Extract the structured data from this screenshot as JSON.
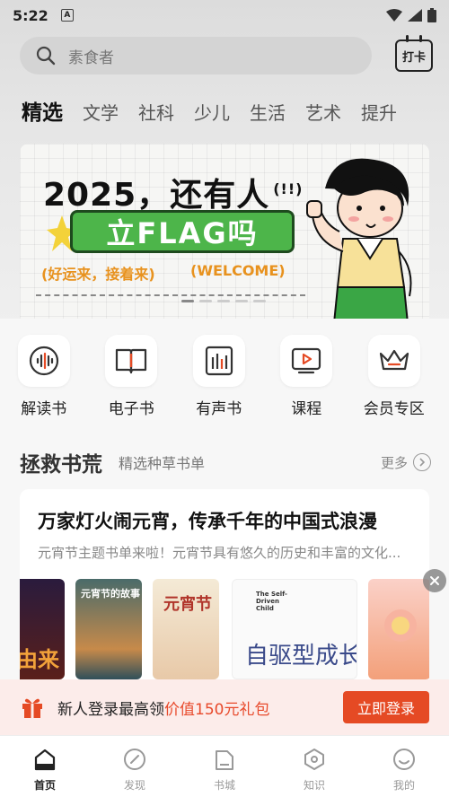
{
  "status_bar": {
    "time": "5:22",
    "notification_badge": "A"
  },
  "search": {
    "placeholder": "素食者"
  },
  "checkin": {
    "label": "打卡"
  },
  "tabs": [
    {
      "label": "精选",
      "active": true
    },
    {
      "label": "文学"
    },
    {
      "label": "社科"
    },
    {
      "label": "少儿"
    },
    {
      "label": "生活"
    },
    {
      "label": "艺术"
    },
    {
      "label": "提升"
    }
  ],
  "banner": {
    "headline": "2025，还有人",
    "exclaim": "(!!)",
    "flag_text": "立FLAG吗",
    "sub_left": "(好运来，接着来)",
    "sub_right": "(WELCOME)"
  },
  "features": [
    {
      "label": "解读书",
      "icon": "audio-wave-icon"
    },
    {
      "label": "电子书",
      "icon": "open-book-icon"
    },
    {
      "label": "有声书",
      "icon": "audio-book-icon"
    },
    {
      "label": "课程",
      "icon": "video-play-icon"
    },
    {
      "label": "会员专区",
      "icon": "crown-icon"
    }
  ],
  "section": {
    "title": "拯救书荒",
    "subtitle": "精选种草书单",
    "more": "更多"
  },
  "booklist": {
    "title": "万家灯火闹元宵，传承千年的中国式浪漫",
    "description": "元宵节主题书单来啦！元宵节具有悠久的历史和丰富的文化...",
    "books": [
      {
        "cover_text": "由来"
      },
      {
        "cover_text": "元宵节的故事"
      },
      {
        "cover_text": "元宵节"
      },
      {
        "cover_text": "The Self-Driven Child",
        "cover_text_cn": "自驱型成长"
      },
      {
        "cover_text": ""
      }
    ]
  },
  "promo": {
    "text": "新人登录最高领",
    "highlight": "价值150元礼包",
    "button": "立即登录"
  },
  "bottom_nav": [
    {
      "label": "首页",
      "icon": "home-icon",
      "active": true
    },
    {
      "label": "发现",
      "icon": "compass-icon"
    },
    {
      "label": "书城",
      "icon": "bookstore-icon"
    },
    {
      "label": "知识",
      "icon": "knowledge-icon"
    },
    {
      "label": "我的",
      "icon": "profile-icon"
    }
  ],
  "colors": {
    "accent": "#e54a24",
    "flag_green": "#4db54a",
    "banner_orange": "#e8921e"
  }
}
